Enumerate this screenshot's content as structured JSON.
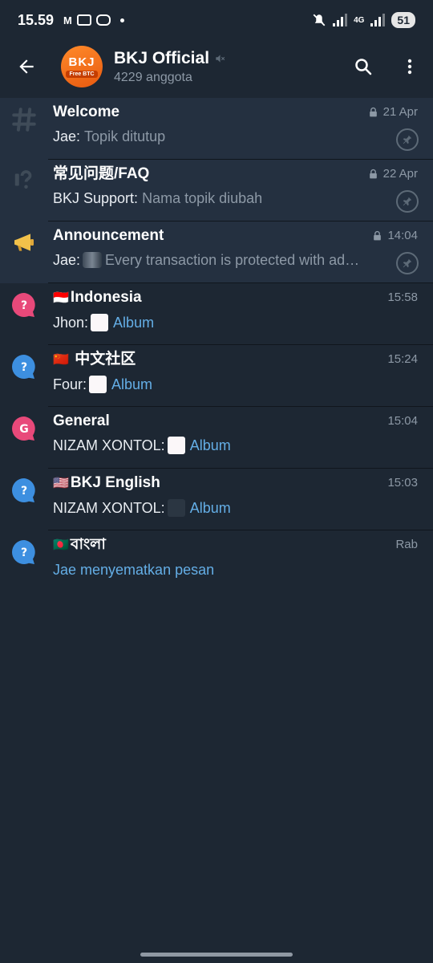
{
  "status": {
    "time": "15.59",
    "network": "4G",
    "battery": "51"
  },
  "header": {
    "back_icon": "arrow-left-icon",
    "avatar_text": "BKJ",
    "avatar_sub": "Free BTC",
    "title": "BKJ Official",
    "muted_icon": "mute-icon",
    "members": "4229 anggota",
    "search_icon": "search-icon",
    "menu_icon": "more-vertical-icon"
  },
  "colors": {
    "background": "#1d2733",
    "pinned_background": "#243040",
    "accent_blue": "#64aee6",
    "muted_text": "#8d99a6",
    "topic_pink": "#e8497a",
    "topic_blue": "#3d8fe0"
  },
  "topics": [
    {
      "name": "Welcome",
      "icon": "hash-icon",
      "sender": "Jae:",
      "message": "Topik ditutup",
      "time": "21 Apr",
      "locked": true,
      "pinned": true
    },
    {
      "name": "常见问题/FAQ",
      "icon": "question-mark-icon",
      "sender": "BKJ Support:",
      "message": "Nama topik diubah",
      "time": "22 Apr",
      "locked": true,
      "pinned": true
    },
    {
      "name": "Announcement",
      "icon": "megaphone-icon",
      "sender": "Jae:",
      "message": "Every transaction is protected with ad…",
      "time": "14:04",
      "locked": true,
      "pinned": true
    },
    {
      "name": "Indonesia",
      "flag": "🇮🇩",
      "icon": "topic-bubble-icon",
      "sender": "Jhon:",
      "message": "Album",
      "time": "15:58"
    },
    {
      "name": "中文社区",
      "flag": "🇨🇳",
      "icon": "topic-bubble-icon",
      "sender": "Four:",
      "message": "Album",
      "time": "15:24"
    },
    {
      "name": "General",
      "icon": "topic-bubble-icon",
      "icon_letter": "G",
      "sender": "NIZAM XONTOL:",
      "message": "Album",
      "time": "15:04"
    },
    {
      "name": "BKJ English",
      "flag": "🇺🇸",
      "icon": "topic-bubble-icon",
      "sender": "NIZAM XONTOL:",
      "message": "Album",
      "time": "15:03"
    },
    {
      "name": "বাংলা",
      "flag": "🇧🇩",
      "icon": "topic-bubble-icon",
      "message": "Jae menyematkan pesan",
      "time": "Rab"
    }
  ]
}
